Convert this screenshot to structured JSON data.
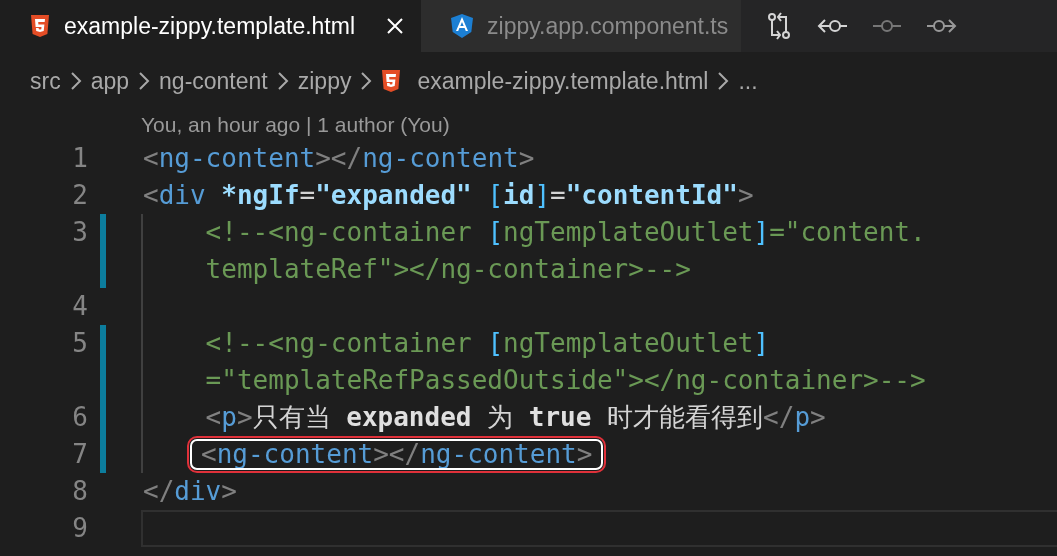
{
  "tabs": [
    {
      "label": "example-zippy.template.html",
      "kind": "html",
      "selected": true
    },
    {
      "label": "zippy.app.component.ts",
      "kind": "angular",
      "selected": false
    }
  ],
  "breadcrumb": [
    {
      "label": "src",
      "kind": "folder"
    },
    {
      "label": "app",
      "kind": "folder"
    },
    {
      "label": "ng-content",
      "kind": "folder"
    },
    {
      "label": "zippy",
      "kind": "folder"
    },
    {
      "label": "example-zippy.template.html",
      "kind": "html"
    },
    {
      "label": "...",
      "kind": "more"
    }
  ],
  "codelens": "You, an hour ago | 1 author (You)",
  "lines": [
    {
      "number": "1",
      "modified": false,
      "highlighted": false,
      "current": false,
      "rows": [
        [
          {
            "text": "<",
            "kind": "punct"
          },
          {
            "text": "ng-content",
            "kind": "tag"
          },
          {
            "text": "></",
            "kind": "punct"
          },
          {
            "text": "ng-content",
            "kind": "tag"
          },
          {
            "text": ">",
            "kind": "punct"
          }
        ]
      ]
    },
    {
      "number": "2",
      "modified": false,
      "highlighted": false,
      "current": false,
      "rows": [
        [
          {
            "text": "<",
            "kind": "punct"
          },
          {
            "text": "div ",
            "kind": "tag"
          },
          {
            "text": "*ngIf",
            "kind": "attr"
          },
          {
            "text": "=",
            "kind": "text"
          },
          {
            "text": "\"expanded\" ",
            "kind": "string"
          },
          {
            "text": "[",
            "kind": "bracket"
          },
          {
            "text": "id",
            "kind": "attr"
          },
          {
            "text": "]",
            "kind": "bracket"
          },
          {
            "text": "=",
            "kind": "text"
          },
          {
            "text": "\"contentId\"",
            "kind": "string"
          },
          {
            "text": ">",
            "kind": "punct"
          }
        ]
      ]
    },
    {
      "number": "3",
      "modified": true,
      "highlighted": false,
      "current": false,
      "rows": [
        [
          {
            "text": "    <!--<ng-container ",
            "kind": "comment"
          },
          {
            "text": "[",
            "kind": "bracket"
          },
          {
            "text": "ngTemplateOutlet",
            "kind": "comment"
          },
          {
            "text": "]",
            "kind": "bracket"
          },
          {
            "text": "=\"content.",
            "kind": "comment"
          }
        ],
        [
          {
            "text": "    templateRef\"></ng-container>-->",
            "kind": "comment"
          }
        ]
      ]
    },
    {
      "number": "4",
      "modified": false,
      "highlighted": false,
      "current": false
    },
    {
      "number": "5",
      "modified": true,
      "highlighted": false,
      "current": false,
      "rows": [
        [
          {
            "text": "    <!--<ng-container ",
            "kind": "comment"
          },
          {
            "text": "[",
            "kind": "bracket"
          },
          {
            "text": "ngTemplateOutlet",
            "kind": "comment"
          },
          {
            "text": "]",
            "kind": "bracket"
          }
        ],
        [
          {
            "text": "    =\"templateRefPassedOutside\"></ng-container>-->",
            "kind": "comment"
          }
        ]
      ]
    },
    {
      "number": "6",
      "modified": true,
      "highlighted": false,
      "current": false,
      "rows": [
        [
          {
            "text": "    <",
            "kind": "punct"
          },
          {
            "text": "p",
            "kind": "tag"
          },
          {
            "text": ">",
            "kind": "punct"
          },
          {
            "text": "只有当 ",
            "kind": "text"
          },
          {
            "text": "expanded",
            "kind": "keyword"
          },
          {
            "text": " 为 ",
            "kind": "text"
          },
          {
            "text": "true",
            "kind": "keyword"
          },
          {
            "text": " 时才能看得到",
            "kind": "text"
          },
          {
            "text": "</",
            "kind": "punct"
          },
          {
            "text": "p",
            "kind": "tag"
          },
          {
            "text": ">",
            "kind": "punct"
          }
        ]
      ]
    },
    {
      "number": "7",
      "modified": true,
      "highlighted": true,
      "current": false,
      "rows": [
        [
          {
            "text": "<",
            "kind": "punct"
          },
          {
            "text": "ng-content",
            "kind": "tag"
          },
          {
            "text": "></",
            "kind": "punct"
          },
          {
            "text": "ng-content",
            "kind": "tag"
          },
          {
            "text": ">",
            "kind": "punct"
          }
        ]
      ]
    },
    {
      "number": "8",
      "modified": false,
      "highlighted": false,
      "current": false,
      "rows": [
        [
          {
            "text": "</",
            "kind": "punct"
          },
          {
            "text": "div",
            "kind": "tag"
          },
          {
            "text": ">",
            "kind": "punct"
          }
        ]
      ]
    },
    {
      "number": "9",
      "modified": false,
      "highlighted": false,
      "current": true
    }
  ]
}
